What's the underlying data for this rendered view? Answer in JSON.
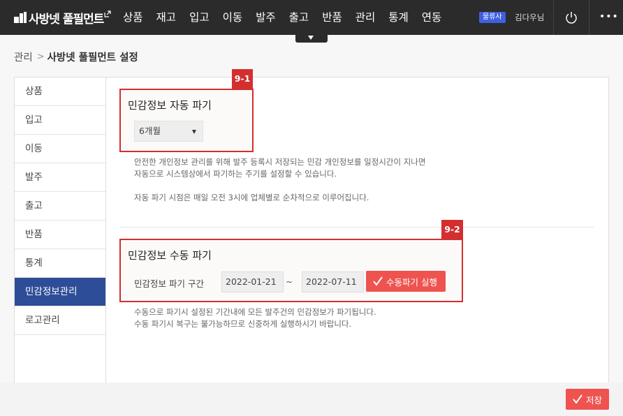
{
  "header": {
    "logo_text": "사방넷 풀필먼트",
    "nav": [
      "상품",
      "재고",
      "입고",
      "이동",
      "발주",
      "출고",
      "반품",
      "관리",
      "통계",
      "연동"
    ],
    "company_badge": "물류사",
    "user_name": "김다우님",
    "power_icon": "power-icon",
    "more_icon": "more-icon",
    "accent_color": "#3f5fe0"
  },
  "breadcrumb": {
    "root": "관리",
    "separator": ">",
    "current": "사방넷 풀필먼트 설정"
  },
  "sidebar": {
    "items": [
      "상품",
      "입고",
      "이동",
      "발주",
      "출고",
      "반품",
      "통계",
      "민감정보관리",
      "로고관리"
    ],
    "active": "민감정보관리",
    "active_color": "#2e4d98"
  },
  "auto_delete": {
    "tag": "9-1",
    "title": "민감정보 자동 파기",
    "period_value": "6개월",
    "desc_line1": "안전한 개인정보 관리를 위해 발주 등록시 저장되는 민감 개인정보를 일정시간이 지나면",
    "desc_line2": "자동으로 시스템상에서 파기하는 주기를 설정할 수 있습니다.",
    "desc_line3": "자동 파기 시점은 매일 오전 3시에 업체별로 순차적으로 이루어집니다."
  },
  "manual_delete": {
    "tag": "9-2",
    "title": "민감정보 수동 파기",
    "range_label": "민감정보 파기 구간",
    "start_date": "2022-01-21",
    "tilde": "~",
    "end_date": "2022-07-11",
    "execute_label": "수동파기 실행",
    "desc_line1": "수동으로 파기시 설정된 기간내에 모든 발주건의 민감정보가 파기됩니다.",
    "desc_line2": "수동 파기시 복구는 불가능하므로 신중하게 실행하시기 바랍니다."
  },
  "footer": {
    "save_label": "저장",
    "button_color": "#ee5350"
  },
  "highlight_color": "#d32f2f"
}
